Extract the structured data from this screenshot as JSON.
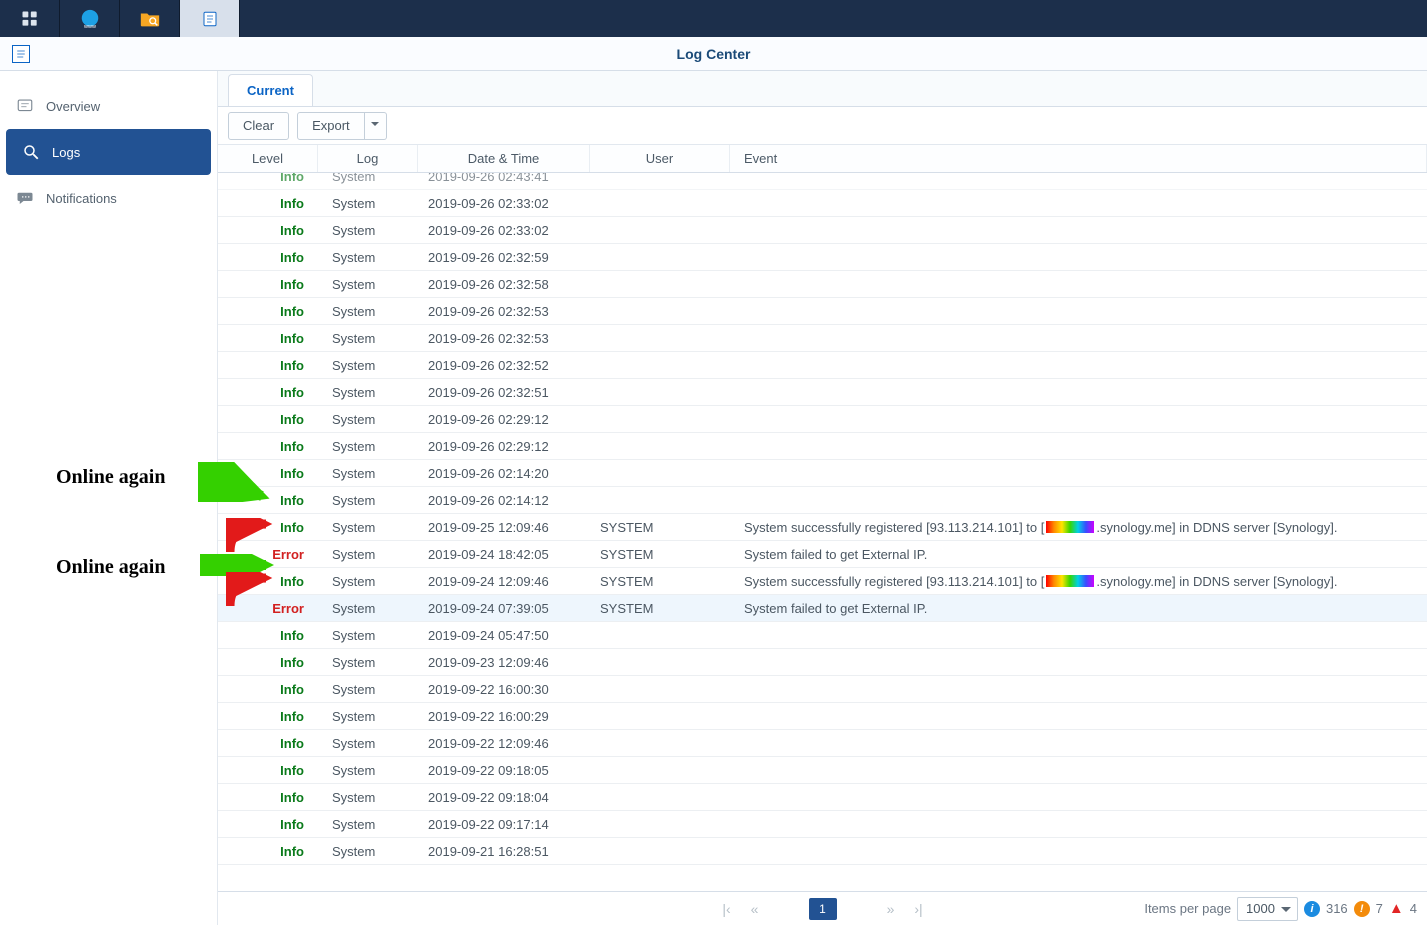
{
  "window": {
    "title": "Log Center"
  },
  "sidebar": {
    "items": [
      {
        "label": "Overview"
      },
      {
        "label": "Logs"
      },
      {
        "label": "Notifications"
      }
    ]
  },
  "tabs": {
    "current": "Current"
  },
  "toolbar": {
    "clear": "Clear",
    "export": "Export"
  },
  "columns": {
    "level": "Level",
    "log": "Log",
    "dt": "Date & Time",
    "user": "User",
    "event": "Event"
  },
  "rows": [
    {
      "level": "Info",
      "log": "System",
      "dt": "2019-09-26 02:43:41",
      "user": "",
      "event": ""
    },
    {
      "level": "Info",
      "log": "System",
      "dt": "2019-09-26 02:33:02",
      "user": "",
      "event": ""
    },
    {
      "level": "Info",
      "log": "System",
      "dt": "2019-09-26 02:33:02",
      "user": "",
      "event": ""
    },
    {
      "level": "Info",
      "log": "System",
      "dt": "2019-09-26 02:32:59",
      "user": "",
      "event": ""
    },
    {
      "level": "Info",
      "log": "System",
      "dt": "2019-09-26 02:32:58",
      "user": "",
      "event": ""
    },
    {
      "level": "Info",
      "log": "System",
      "dt": "2019-09-26 02:32:53",
      "user": "",
      "event": ""
    },
    {
      "level": "Info",
      "log": "System",
      "dt": "2019-09-26 02:32:53",
      "user": "",
      "event": ""
    },
    {
      "level": "Info",
      "log": "System",
      "dt": "2019-09-26 02:32:52",
      "user": "",
      "event": ""
    },
    {
      "level": "Info",
      "log": "System",
      "dt": "2019-09-26 02:32:51",
      "user": "",
      "event": ""
    },
    {
      "level": "Info",
      "log": "System",
      "dt": "2019-09-26 02:29:12",
      "user": "",
      "event": ""
    },
    {
      "level": "Info",
      "log": "System",
      "dt": "2019-09-26 02:29:12",
      "user": "",
      "event": ""
    },
    {
      "level": "Info",
      "log": "System",
      "dt": "2019-09-26 02:14:20",
      "user": "",
      "event": ""
    },
    {
      "level": "Info",
      "log": "System",
      "dt": "2019-09-26 02:14:12",
      "user": "",
      "event": ""
    },
    {
      "level": "Info",
      "log": "System",
      "dt": "2019-09-25 12:09:46",
      "user": "SYSTEM",
      "event_before": "System successfully registered [93.113.214.101] to [",
      "event_after": ".synology.me] in DDNS server [Synology].",
      "redacted": true
    },
    {
      "level": "Error",
      "log": "System",
      "dt": "2019-09-24 18:42:05",
      "user": "SYSTEM",
      "event": "System failed to get External IP."
    },
    {
      "level": "Info",
      "log": "System",
      "dt": "2019-09-24 12:09:46",
      "user": "SYSTEM",
      "event_before": "System successfully registered [93.113.214.101] to [",
      "event_after": ".synology.me] in DDNS server [Synology].",
      "redacted": true
    },
    {
      "level": "Error",
      "log": "System",
      "dt": "2019-09-24 07:39:05",
      "user": "SYSTEM",
      "event": "System failed to get External IP.",
      "highlight": true
    },
    {
      "level": "Info",
      "log": "System",
      "dt": "2019-09-24 05:47:50",
      "user": "",
      "event": ""
    },
    {
      "level": "Info",
      "log": "System",
      "dt": "2019-09-23 12:09:46",
      "user": "",
      "event": ""
    },
    {
      "level": "Info",
      "log": "System",
      "dt": "2019-09-22 16:00:30",
      "user": "",
      "event": ""
    },
    {
      "level": "Info",
      "log": "System",
      "dt": "2019-09-22 16:00:29",
      "user": "",
      "event": ""
    },
    {
      "level": "Info",
      "log": "System",
      "dt": "2019-09-22 12:09:46",
      "user": "",
      "event": ""
    },
    {
      "level": "Info",
      "log": "System",
      "dt": "2019-09-22 09:18:05",
      "user": "",
      "event": ""
    },
    {
      "level": "Info",
      "log": "System",
      "dt": "2019-09-22 09:18:04",
      "user": "",
      "event": ""
    },
    {
      "level": "Info",
      "log": "System",
      "dt": "2019-09-22 09:17:14",
      "user": "",
      "event": ""
    },
    {
      "level": "Info",
      "log": "System",
      "dt": "2019-09-21 16:28:51",
      "user": "",
      "event": ""
    }
  ],
  "pager": {
    "page": "1",
    "ipp_label": "Items per page",
    "ipp_value": "1000",
    "count_info": "316",
    "count_warn": "7",
    "count_err": "4"
  },
  "annotations": {
    "a1": "Online again",
    "a2": "Online again"
  }
}
